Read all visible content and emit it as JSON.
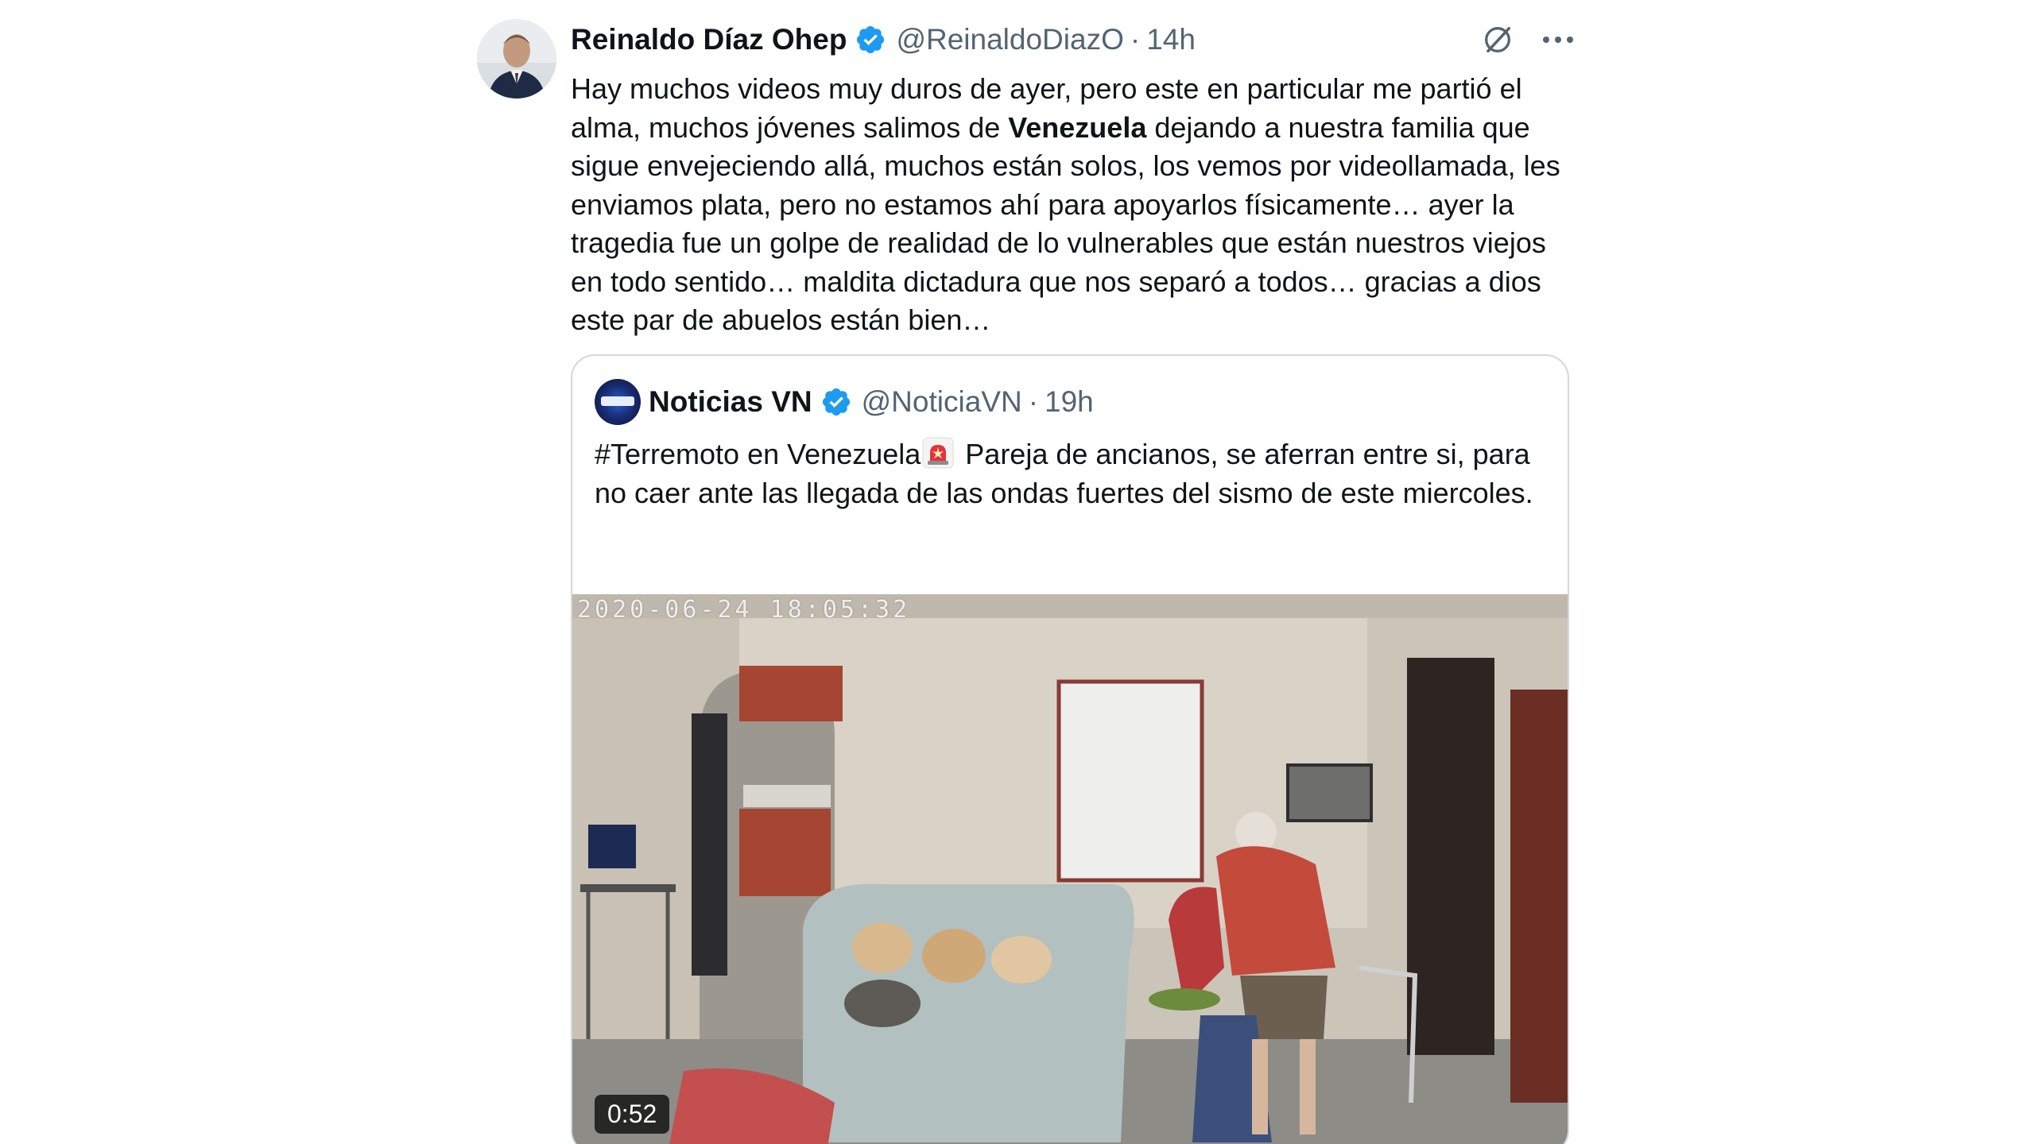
{
  "tweet": {
    "author_name": "Reinaldo Díaz Ohep",
    "handle": "@ReinaldoDiazO",
    "separator": "·",
    "time": "14h",
    "text_part1": "Hay muchos videos muy duros de ayer, pero este en particular me partió el alma, muchos jóvenes salimos de ",
    "text_bold": "Venezuela",
    "text_part2": " dejando a nuestra familia que sigue envejeciendo allá, muchos están solos, los vemos por videollamada, les enviamos plata, pero no estamos ahí para apoyarlos físicamente… ayer la tragedia fue un golpe de realidad de lo vulnerables que están nuestros viejos en todo sentido… maldita dictadura que nos separó a todos… gracias a dios este par de abuelos están bien…",
    "icons": [
      "avatar",
      "verified-badge-icon",
      "grok-icon",
      "more-icon"
    ]
  },
  "quoted_tweet": {
    "author_name": "Noticias VN",
    "handle": "@NoticiaVN",
    "separator": "·",
    "time": "19h",
    "text_part1": "#Terremoto en Venezuela",
    "text_part2": " Pareja de ancianos, se aferran entre si, para no caer ante las llegada de las ondas fuertes del sismo de este miercoles.",
    "media": {
      "overlay_timestamp": "2020-06-24  18:05:32",
      "duration": "0:52"
    }
  },
  "colors": {
    "text_primary": "#0f1419",
    "text_secondary": "#536471",
    "verified_blue": "#1d9bf0",
    "border": "#cfd9de"
  }
}
